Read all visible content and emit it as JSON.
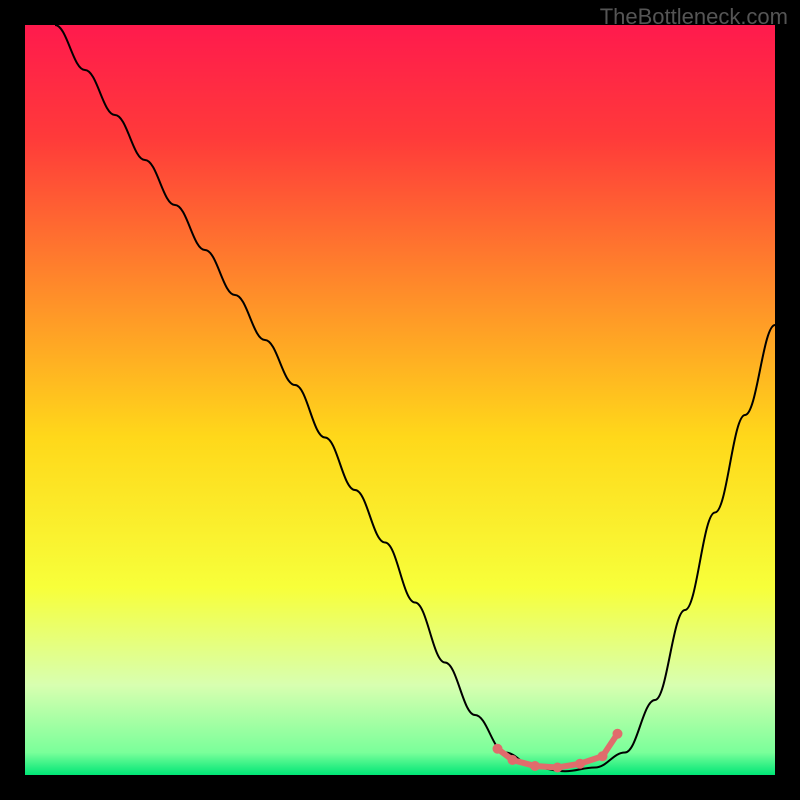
{
  "watermark": "TheBottleneck.com",
  "chart_data": {
    "type": "line",
    "title": "",
    "xlabel": "",
    "ylabel": "",
    "xlim": [
      0,
      100
    ],
    "ylim": [
      0,
      100
    ],
    "background_gradient": {
      "stops": [
        {
          "offset": 0,
          "color": "#ff1a4d"
        },
        {
          "offset": 0.15,
          "color": "#ff3a3a"
        },
        {
          "offset": 0.35,
          "color": "#ff8a2a"
        },
        {
          "offset": 0.55,
          "color": "#ffd81a"
        },
        {
          "offset": 0.75,
          "color": "#f7ff3a"
        },
        {
          "offset": 0.88,
          "color": "#d8ffb0"
        },
        {
          "offset": 0.97,
          "color": "#7aff9a"
        },
        {
          "offset": 1.0,
          "color": "#00e676"
        }
      ]
    },
    "series": [
      {
        "name": "bottleneck-curve",
        "color": "#000000",
        "width": 2,
        "x": [
          4,
          8,
          12,
          16,
          20,
          24,
          28,
          32,
          36,
          40,
          44,
          48,
          52,
          56,
          60,
          64,
          68,
          72,
          76,
          80,
          84,
          88,
          92,
          96,
          100
        ],
        "y": [
          100,
          94,
          88,
          82,
          76,
          70,
          64,
          58,
          52,
          45,
          38,
          31,
          23,
          15,
          8,
          3,
          1,
          0.5,
          1,
          3,
          10,
          22,
          35,
          48,
          60
        ]
      }
    ],
    "highlight": {
      "name": "optimal-zone",
      "color": "#e06c6c",
      "points": [
        {
          "x": 63,
          "y": 3.5
        },
        {
          "x": 65,
          "y": 2.0
        },
        {
          "x": 68,
          "y": 1.2
        },
        {
          "x": 71,
          "y": 1.0
        },
        {
          "x": 74,
          "y": 1.5
        },
        {
          "x": 77,
          "y": 2.5
        },
        {
          "x": 79,
          "y": 5.5
        }
      ]
    }
  }
}
